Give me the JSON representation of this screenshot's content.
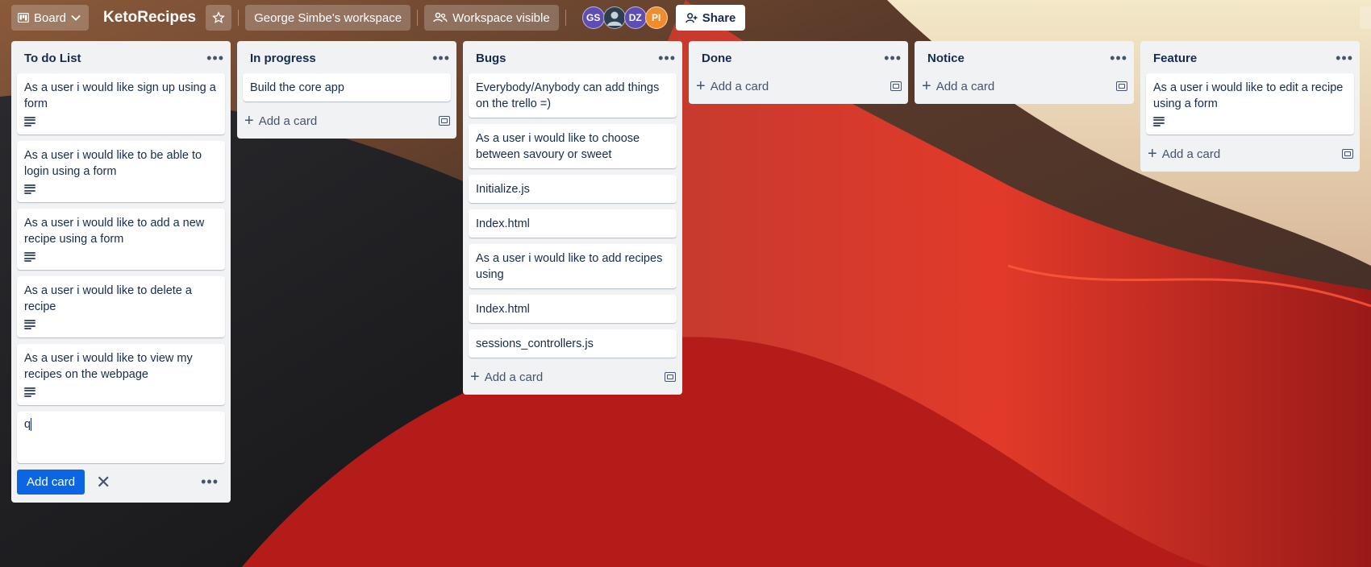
{
  "header": {
    "board_switch_label": "Board",
    "board_title": "KetoRecipes",
    "workspace_label": "George Simbe's workspace",
    "visibility_label": "Workspace visible",
    "share_label": "Share",
    "members": [
      {
        "initials": "GS",
        "color": "#5e4db2"
      },
      {
        "initials": "",
        "color": "#2c3e50"
      },
      {
        "initials": "DZ",
        "color": "#5e4db2"
      },
      {
        "initials": "PI",
        "color": "#f08c2e"
      }
    ]
  },
  "lists": [
    {
      "title": "To do List",
      "cards": [
        {
          "text": "As a user i would like sign up using a form",
          "has_description": true
        },
        {
          "text": "As a user i would like to be able to login using a form",
          "has_description": true
        },
        {
          "text": "As a user i would like to add a new recipe using a form",
          "has_description": true
        },
        {
          "text": "As a user i would like to delete a recipe",
          "has_description": true
        },
        {
          "text": "As a user i would like to view my recipes on the webpage",
          "has_description": true
        }
      ],
      "composer": {
        "value": "q",
        "add_label": "Add card"
      }
    },
    {
      "title": "In progress",
      "cards": [
        {
          "text": "Build the core app"
        }
      ],
      "add_label": "Add a card"
    },
    {
      "title": "Bugs",
      "cards": [
        {
          "text": "Everybody/Anybody can add things on the trello =)"
        },
        {
          "text": "As a user i would like to choose between savoury or sweet"
        },
        {
          "text": "Initialize.js"
        },
        {
          "text": "Index.html"
        },
        {
          "text": "As a user i would like to add recipes using"
        },
        {
          "text": "Index.html"
        },
        {
          "text": "sessions_controllers.js"
        }
      ],
      "add_label": "Add a card"
    },
    {
      "title": "Done",
      "cards": [],
      "add_label": "Add a card"
    },
    {
      "title": "Notice",
      "cards": [],
      "add_label": "Add a card"
    },
    {
      "title": "Feature",
      "cards": [
        {
          "text": "As a user i would like to edit a recipe using a form",
          "has_description": true
        }
      ],
      "add_label": "Add a card"
    }
  ]
}
